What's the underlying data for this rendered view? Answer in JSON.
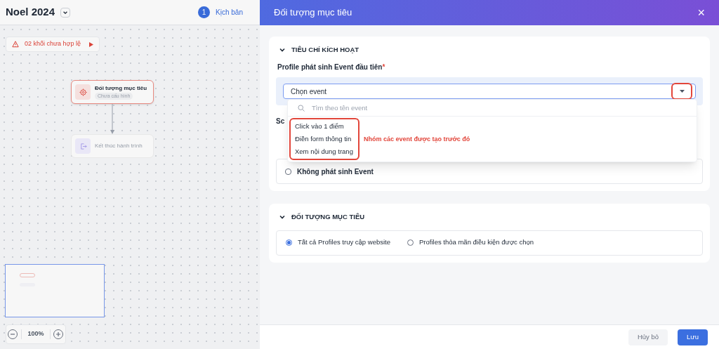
{
  "project": {
    "title": "Noel 2024"
  },
  "steps": [
    {
      "number": "1",
      "label": "Kịch bản",
      "selected": true
    }
  ],
  "warning": {
    "text": "02 khối chưa hợp lệ"
  },
  "nodes": [
    {
      "kind": "target",
      "title": "Đối tượng mục tiêu",
      "subtitle": "Chưa cấu hình",
      "invalid": true
    },
    {
      "kind": "exit",
      "title": "Kết thúc hành trình",
      "invalid": false
    }
  ],
  "zoom": {
    "value": "100%"
  },
  "drawer": {
    "title": "Đối tượng mục tiêu",
    "close": "×",
    "trigger_section": {
      "title": "TIÊU CHÍ KÍCH HOẠT",
      "expanded": true,
      "field_label": "Profile phát sinh Event đầu tiên",
      "required_mark": "*",
      "select": {
        "value": "Chọn event",
        "open": true
      },
      "dropdown": {
        "search_placeholder": "Tìm theo tên event",
        "options": [
          "Click vào 1 điểm",
          "Điền form thông tin",
          "Xem nội dung trang"
        ]
      },
      "annotation": "Nhóm các event được tạo trước đó",
      "hidden_label": "Sc",
      "checkbox": {
        "label": "Không phát sinh Event",
        "checked": false
      }
    },
    "target_section": {
      "title": "ĐỐI TƯỢNG MỤC TIÊU",
      "expanded": true,
      "radios": [
        {
          "label": "Tất cả Profiles truy cập website",
          "selected": true
        },
        {
          "label": "Profiles thỏa mãn điều kiện được chọn",
          "selected": false
        }
      ]
    },
    "buttons": [
      {
        "kind": "secondary",
        "label": "Hủy bỏ"
      },
      {
        "kind": "primary",
        "label": "Lưu"
      }
    ]
  }
}
